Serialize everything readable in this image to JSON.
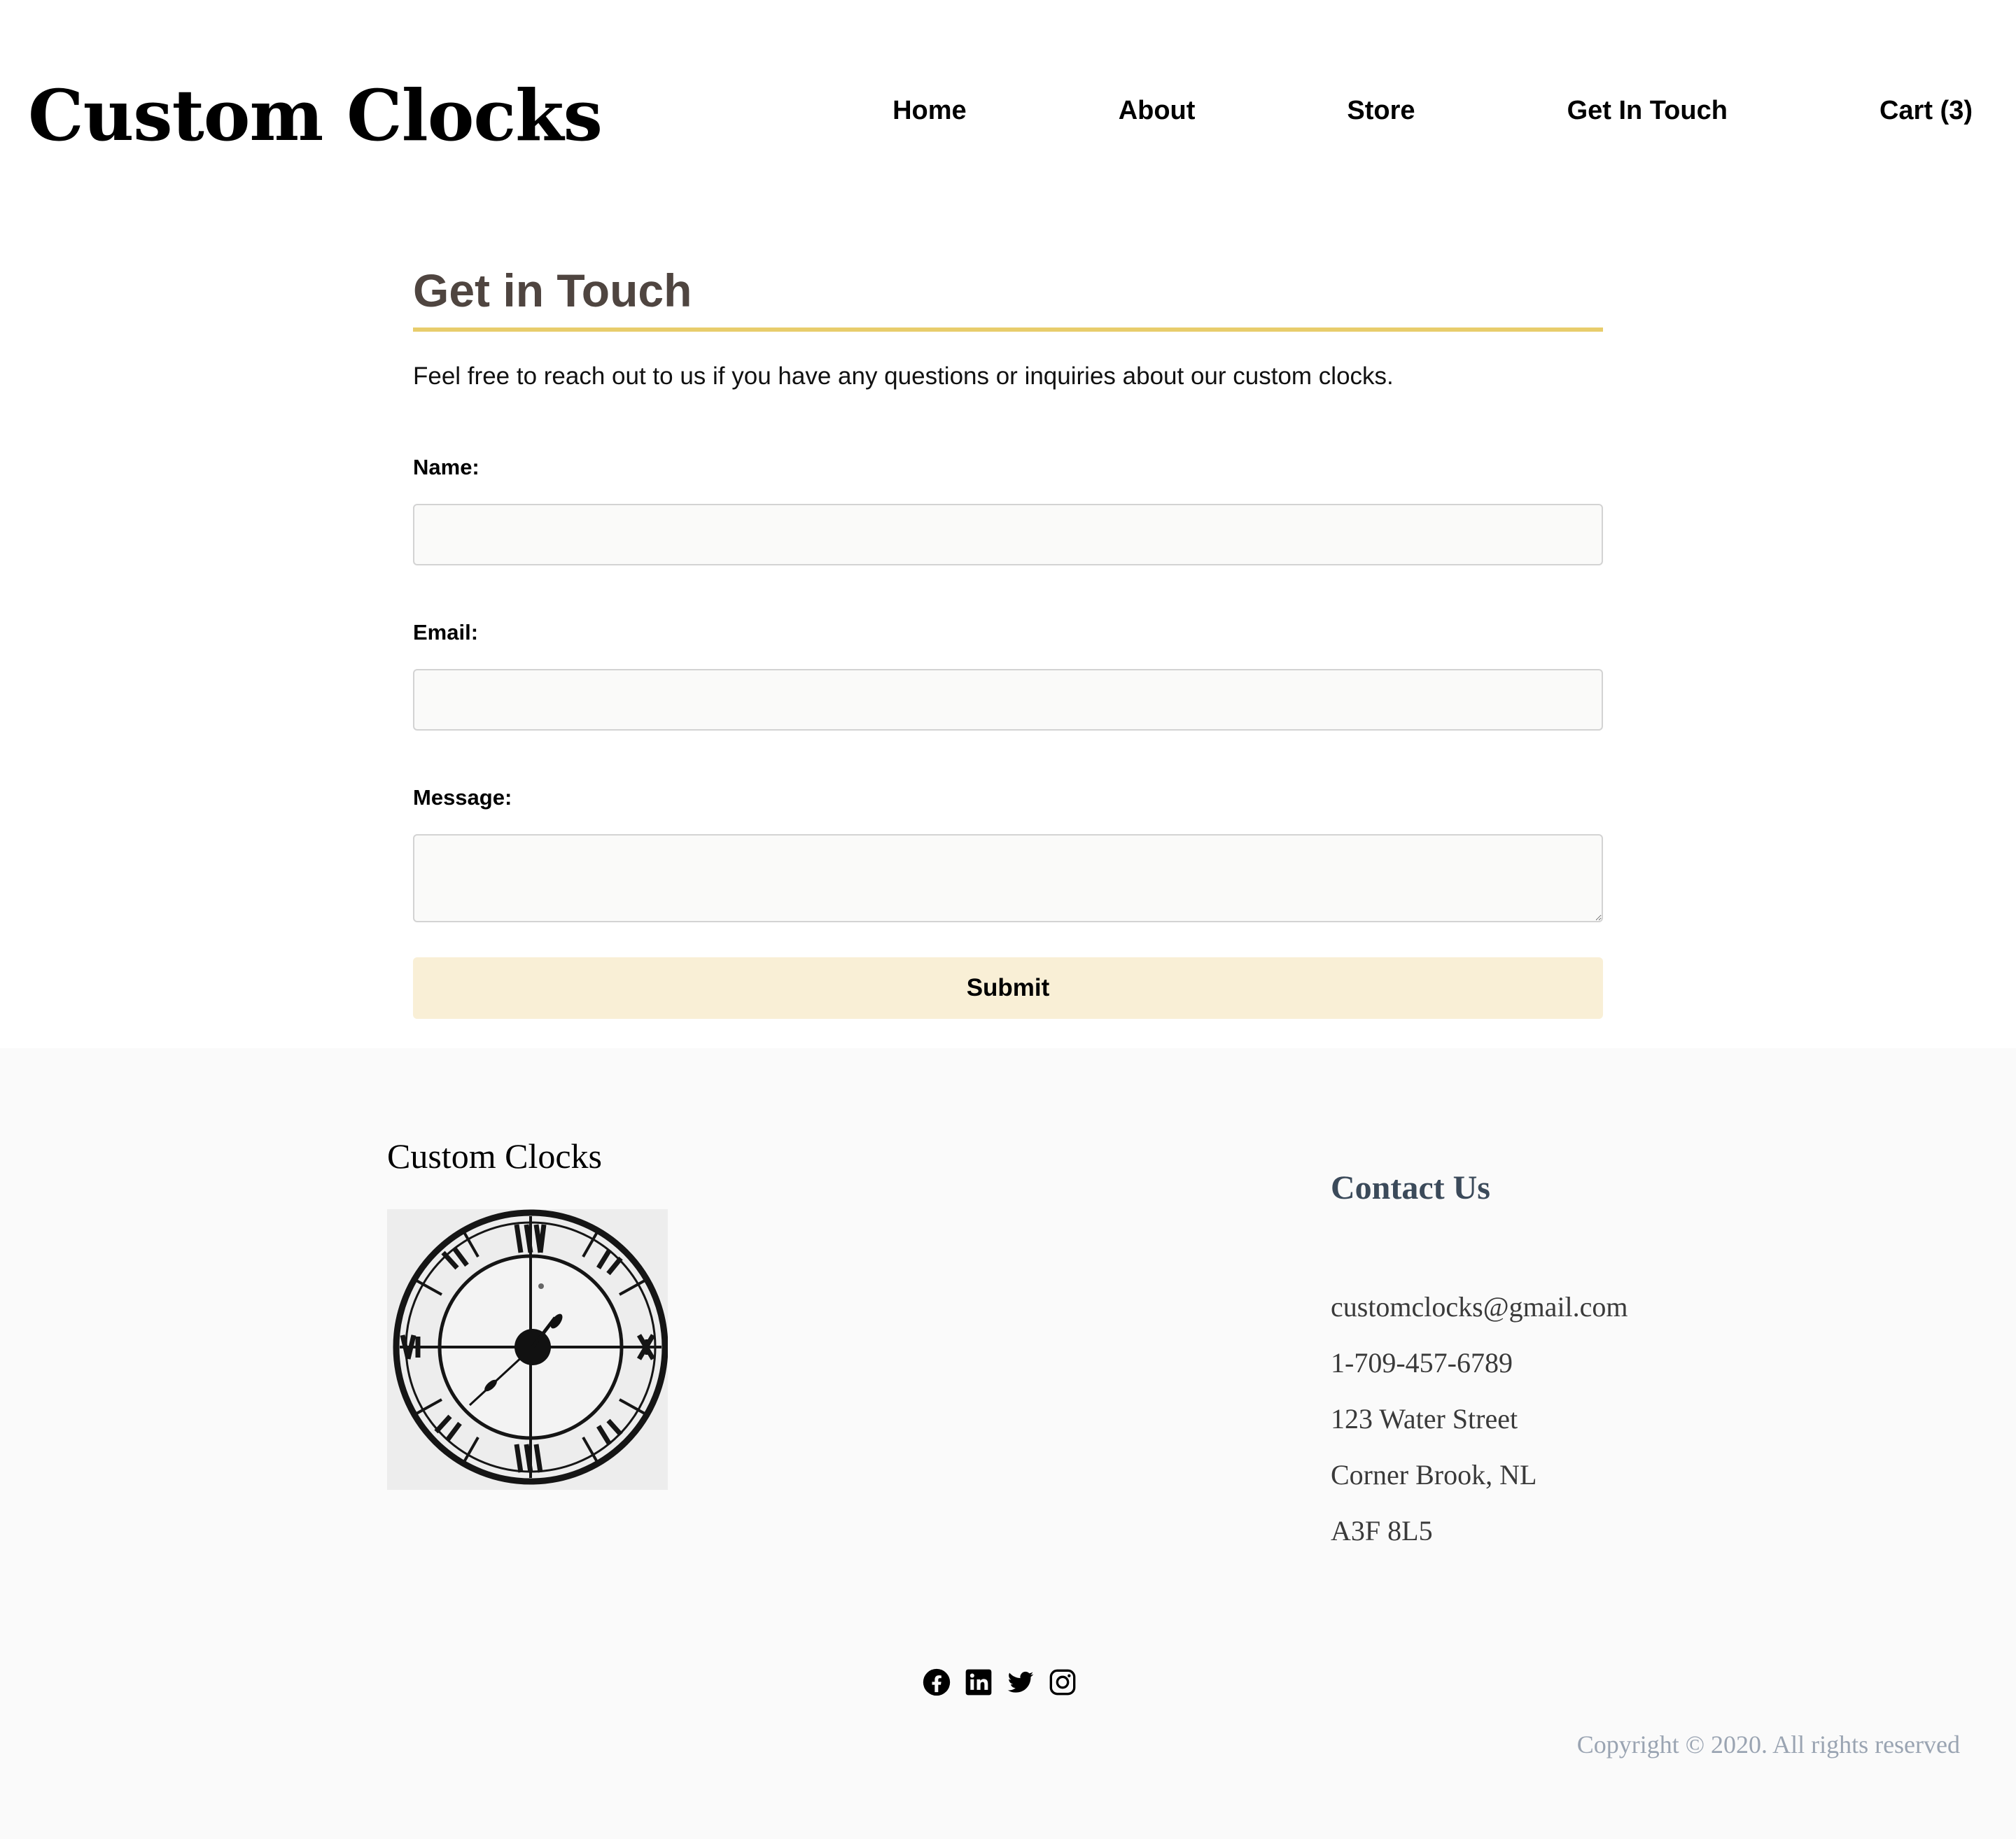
{
  "header": {
    "brand": "Custom Clocks",
    "nav": [
      "Home",
      "About",
      "Store",
      "Get In Touch",
      "Cart (3)"
    ]
  },
  "contact_form": {
    "title": "Get in Touch",
    "intro": "Feel free to reach out to us if you have any questions or inquiries about our custom clocks.",
    "name_label": "Name:",
    "name_value": "",
    "email_label": "Email:",
    "email_value": "",
    "message_label": "Message:",
    "message_value": "",
    "submit_label": "Submit"
  },
  "footer": {
    "brand": "Custom Clocks",
    "image_icon": "roman-numeral-wall-clock",
    "contact_heading": "Contact Us",
    "email": "customclocks@gmail.com",
    "phone": "1-709-457-6789",
    "street": "123 Water Street",
    "city": "Corner Brook, NL",
    "postal": "A3F 8L5",
    "social": [
      "facebook-icon",
      "linkedin-icon",
      "twitter-icon",
      "instagram-icon"
    ],
    "copyright": "Copyright © 2020. All rights reserved"
  },
  "colors": {
    "title": "#4f4540",
    "title_rule": "#e8cd6c",
    "submit_bg": "#f9efd6",
    "footer_bg": "#fafafa",
    "contact_heading": "#3b4a5a",
    "copyright": "#9aa4b2"
  }
}
